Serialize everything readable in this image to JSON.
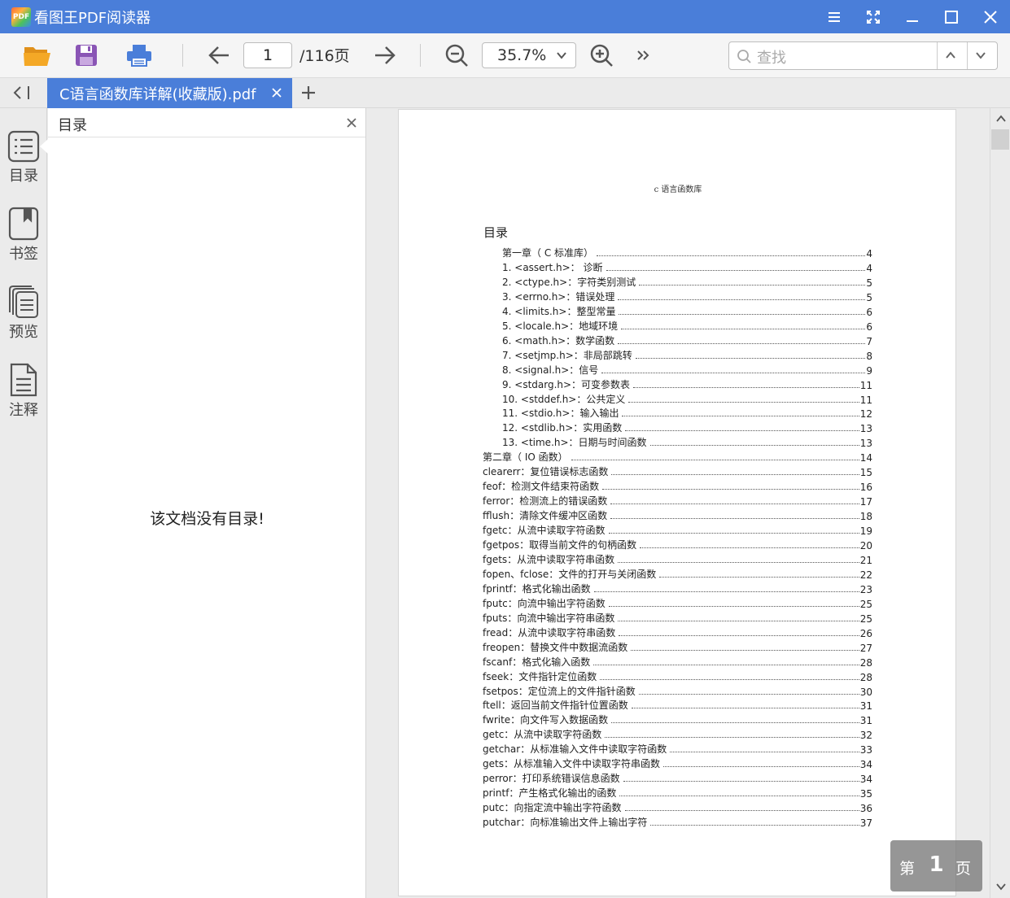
{
  "app": {
    "logo_text": "PDF",
    "title": "看图王PDF阅读器"
  },
  "toolbar": {
    "current_page": "1",
    "total_pages": "/116页",
    "zoom": "35.7%",
    "search_placeholder": "查找"
  },
  "tabs": [
    {
      "label": "C语言函数库详解(收藏版).pdf",
      "active": true
    }
  ],
  "sidebar": {
    "items": [
      {
        "label": "目录",
        "icon": "list-icon"
      },
      {
        "label": "书签",
        "icon": "bookmark-icon"
      },
      {
        "label": "预览",
        "icon": "pages-icon"
      },
      {
        "label": "注释",
        "icon": "note-icon"
      }
    ]
  },
  "outline": {
    "title": "目录",
    "empty_message": "该文档没有目录!"
  },
  "page": {
    "header": "c 语言函数库",
    "toc_title": "目录",
    "toc": [
      {
        "text": "第一章（ C 标准库）",
        "page": "4",
        "indent": 1
      },
      {
        "text": "1. <assert.h>： 诊断",
        "page": "4",
        "indent": 1
      },
      {
        "text": "2. <ctype.h>：字符类别测试",
        "page": "5",
        "indent": 1
      },
      {
        "text": "3. <errno.h>：错误处理",
        "page": "5",
        "indent": 1
      },
      {
        "text": "4. <limits.h>：整型常量",
        "page": "6",
        "indent": 1
      },
      {
        "text": "5. <locale.h>：地域环境",
        "page": "6",
        "indent": 1
      },
      {
        "text": "6. <math.h>：数学函数",
        "page": "7",
        "indent": 1
      },
      {
        "text": "7. <setjmp.h>：非局部跳转",
        "page": "8",
        "indent": 1
      },
      {
        "text": "8. <signal.h>：信号",
        "page": "9",
        "indent": 1
      },
      {
        "text": "9. <stdarg.h>：可变参数表",
        "page": "11",
        "indent": 1
      },
      {
        "text": "10. <stddef.h>：公共定义",
        "page": "11",
        "indent": 1
      },
      {
        "text": "11. <stdio.h>：输入输出",
        "page": "12",
        "indent": 1
      },
      {
        "text": "12. <stdlib.h>：实用函数",
        "page": "13",
        "indent": 1
      },
      {
        "text": "13. <time.h>：日期与时间函数",
        "page": "13",
        "indent": 1
      },
      {
        "text": "第二章（ IO 函数）",
        "page": "14",
        "indent": 0
      },
      {
        "text": "clearerr：复位错误标志函数",
        "page": "15",
        "indent": 0
      },
      {
        "text": "feof：检测文件结束符函数",
        "page": "16",
        "indent": 0
      },
      {
        "text": "ferror：检测流上的错误函数",
        "page": "17",
        "indent": 0
      },
      {
        "text": "fflush：清除文件缓冲区函数",
        "page": "18",
        "indent": 0
      },
      {
        "text": "fgetc：从流中读取字符函数",
        "page": "19",
        "indent": 0
      },
      {
        "text": "fgetpos：取得当前文件的句柄函数",
        "page": "20",
        "indent": 0
      },
      {
        "text": "fgets：从流中读取字符串函数",
        "page": "21",
        "indent": 0
      },
      {
        "text": "fopen、fclose：文件的打开与关闭函数",
        "page": "22",
        "indent": 0
      },
      {
        "text": "fprintf：格式化输出函数",
        "page": "23",
        "indent": 0
      },
      {
        "text": "fputc：向流中输出字符函数",
        "page": "25",
        "indent": 0
      },
      {
        "text": "fputs：向流中输出字符串函数",
        "page": "25",
        "indent": 0
      },
      {
        "text": "fread：从流中读取字符串函数",
        "page": "26",
        "indent": 0
      },
      {
        "text": "freopen：替换文件中数据流函数",
        "page": "27",
        "indent": 0
      },
      {
        "text": "fscanf：格式化输入函数",
        "page": "28",
        "indent": 0
      },
      {
        "text": "fseek：文件指针定位函数",
        "page": "28",
        "indent": 0
      },
      {
        "text": "fsetpos：定位流上的文件指针函数",
        "page": "30",
        "indent": 0
      },
      {
        "text": "ftell：返回当前文件指针位置函数",
        "page": "31",
        "indent": 0
      },
      {
        "text": "fwrite：向文件写入数据函数",
        "page": "31",
        "indent": 0
      },
      {
        "text": "getc：从流中读取字符函数",
        "page": "32",
        "indent": 0
      },
      {
        "text": "getchar：从标准输入文件中读取字符函数",
        "page": "33",
        "indent": 0
      },
      {
        "text": "gets：从标准输入文件中读取字符串函数",
        "page": "34",
        "indent": 0
      },
      {
        "text": "perror：打印系统错误信息函数",
        "page": "34",
        "indent": 0
      },
      {
        "text": "printf：产生格式化输出的函数",
        "page": "35",
        "indent": 0
      },
      {
        "text": "putc：向指定流中输出字符函数",
        "page": "36",
        "indent": 0
      },
      {
        "text": "putchar：向标准输出文件上输出字符",
        "page": "37",
        "indent": 0
      }
    ]
  },
  "page_badge": {
    "prefix": "第",
    "number": "1",
    "suffix": "页"
  },
  "colors": {
    "accent": "#4a7ed9",
    "folder": "#f4a826",
    "save": "#8a55b5",
    "print": "#4a7ed9"
  }
}
